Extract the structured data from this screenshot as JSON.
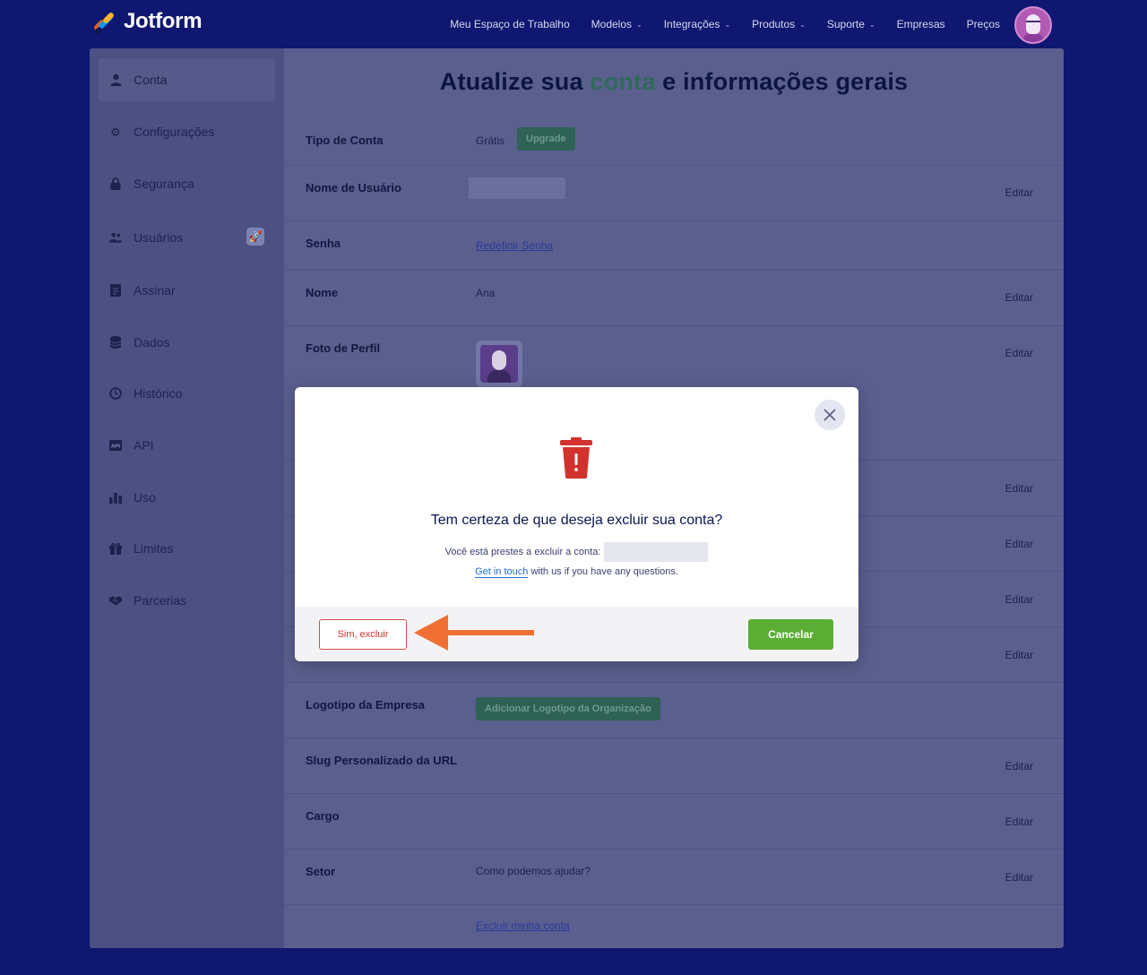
{
  "brand": {
    "name": "Jotform"
  },
  "nav": {
    "items": [
      {
        "label": "Meu Espaço de Trabalho",
        "dropdown": false
      },
      {
        "label": "Modelos",
        "dropdown": true
      },
      {
        "label": "Integrações",
        "dropdown": true
      },
      {
        "label": "Produtos",
        "dropdown": true
      },
      {
        "label": "Suporte",
        "dropdown": true
      },
      {
        "label": "Empresas",
        "dropdown": false
      },
      {
        "label": "Preços",
        "dropdown": false
      }
    ]
  },
  "sidebar": {
    "items": [
      {
        "label": "Conta",
        "icon": "user-icon",
        "active": true
      },
      {
        "label": "Configurações",
        "icon": "gear-icon"
      },
      {
        "label": "Segurança",
        "icon": "lock-icon"
      },
      {
        "label": "Usuários",
        "icon": "users-icon",
        "badge": "rocket-icon"
      },
      {
        "label": "Assinar",
        "icon": "sign-icon"
      },
      {
        "label": "Dados",
        "icon": "database-icon"
      },
      {
        "label": "Histórico",
        "icon": "history-icon"
      },
      {
        "label": "API",
        "icon": "api-icon"
      },
      {
        "label": "Uso",
        "icon": "bar-chart-icon"
      },
      {
        "label": "Limites",
        "icon": "gift-icon"
      },
      {
        "label": "Parcerias",
        "icon": "handshake-icon"
      }
    ]
  },
  "page": {
    "title_pre": "Atualize sua ",
    "title_accent": "conta",
    "title_post": " e informações gerais"
  },
  "account": {
    "tipo_label": "Tipo de Conta",
    "tipo_value": "Grátis",
    "upgrade_label": "Upgrade",
    "usuario_label": "Nome de Usuário",
    "senha_label": "Senha",
    "senha_link": "Redefinir Senha",
    "nome_label": "Nome",
    "nome_value": "Ana",
    "foto_label": "Foto de Perfil",
    "logo_label": "Logotipo da Empresa",
    "logo_button": "Adicionar Logotipo da Organização",
    "slug_label": "Slug Personalizado da URL",
    "cargo_label": "Cargo",
    "setor_label": "Setor",
    "setor_value": "Como podemos ajudar?",
    "delete_link": "Excluir minha conta",
    "edit_label": "Editar"
  },
  "modal": {
    "title": "Tem certeza de que deseja excluir sua conta?",
    "subtitle": "Você está prestes a excluir a conta:",
    "help_link": "Get in touch",
    "help_text": " with us if you have any questions.",
    "confirm_label": "Sim, excluir",
    "cancel_label": "Cancelar"
  },
  "colors": {
    "page_bg": "#0f1770",
    "danger": "#d2312d",
    "success": "#5aae34",
    "annotation_arrow": "#f07033"
  }
}
